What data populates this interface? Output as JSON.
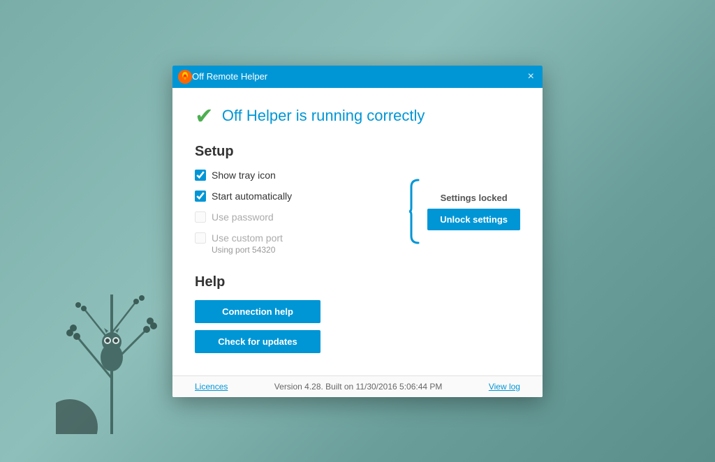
{
  "background": {
    "description": "Teal/gray-green gradient desktop background with decorative plant silhouette"
  },
  "window": {
    "title": "Off Remote Helper",
    "close_label": "×"
  },
  "status": {
    "icon": "✔",
    "text": "Off Helper is running correctly"
  },
  "setup": {
    "section_title": "Setup",
    "checkboxes": [
      {
        "id": "show-tray",
        "label": "Show tray icon",
        "checked": true,
        "disabled": false
      },
      {
        "id": "start-auto",
        "label": "Start automatically",
        "checked": true,
        "disabled": false
      },
      {
        "id": "use-password",
        "label": "Use password",
        "checked": false,
        "disabled": true
      },
      {
        "id": "use-custom-port",
        "label": "Use custom port",
        "checked": false,
        "disabled": true,
        "note": "Using port 54320"
      }
    ],
    "lock": {
      "locked_text": "Settings locked",
      "unlock_button_label": "Unlock settings"
    }
  },
  "help": {
    "section_title": "Help",
    "buttons": [
      {
        "id": "connection-help",
        "label": "Connection help"
      },
      {
        "id": "check-updates",
        "label": "Check for updates"
      }
    ]
  },
  "footer": {
    "licences_link": "Licences",
    "version_text": "Version 4.28. Built on 11/30/2016 5:06:44 PM",
    "view_log_link": "View log"
  }
}
